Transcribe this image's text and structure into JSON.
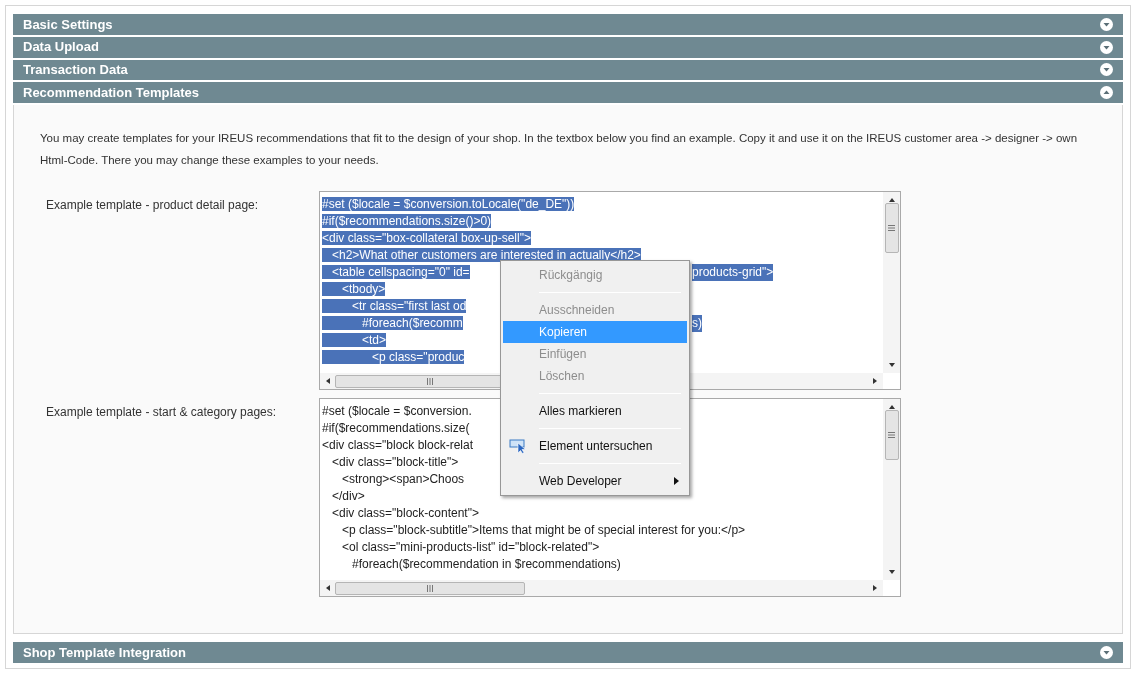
{
  "sections_top": [
    {
      "title": "Basic Settings",
      "expanded": false
    },
    {
      "title": "Data Upload",
      "expanded": false
    },
    {
      "title": "Transaction Data",
      "expanded": false
    },
    {
      "title": "Recommendation Templates",
      "expanded": true
    }
  ],
  "intro": "You may create templates for your IREUS recommendations that fit to the design of your shop. In the textbox below you find an example. Copy it and use it on the IREUS customer area -> designer -> own Html-Code. There you may change these examples to your needs.",
  "templates": [
    {
      "label": "Example template - product detail page:",
      "selected": true,
      "lines": [
        {
          "left": "#set ($locale = $conversion.toLocale(\"de_DE\"))"
        },
        {
          "left": "#if($recommendations.size()>0)"
        },
        {
          "left": "<div class=\"box-collateral box-up-sell\">"
        },
        {
          "left": "   <h2>What other customers are interested in actually</h2>"
        },
        {
          "left": "   <table cellspacing=\"0\" id=",
          "right": "products-grid\">"
        },
        {
          "left": "      <tbody>"
        },
        {
          "left": "         <tr class=\"first last od"
        },
        {
          "left": "            #foreach($recomm",
          "right": "s)"
        },
        {
          "left": "            <td>"
        },
        {
          "left": "               <p class=\"produc"
        }
      ]
    },
    {
      "label": "Example template - start & category pages:",
      "selected": false,
      "lines": [
        {
          "left": "#set ($locale = $conversion."
        },
        {
          "left": "#if($recommendations.size("
        },
        {
          "left": "<div class=\"block block-relat"
        },
        {
          "left": "   <div class=\"block-title\">"
        },
        {
          "left": "      <strong><span>Choos"
        },
        {
          "left": "   </div>"
        },
        {
          "left": "   <div class=\"block-content\">"
        },
        {
          "left": "      <p class=\"block-subtitle\">Items that might be of special interest for you:</p>"
        },
        {
          "left": "      <ol class=\"mini-products-list\" id=\"block-related\">"
        },
        {
          "left": "         #foreach($recommendation in $recommendations)"
        }
      ]
    }
  ],
  "context_menu": [
    {
      "kind": "item",
      "label": "Rückgängig",
      "disabled": true,
      "selected": false,
      "icon": false,
      "submenu": false
    },
    {
      "kind": "separator"
    },
    {
      "kind": "item",
      "label": "Ausschneiden",
      "disabled": true,
      "selected": false,
      "icon": false,
      "submenu": false
    },
    {
      "kind": "item",
      "label": "Kopieren",
      "disabled": false,
      "selected": true,
      "icon": false,
      "submenu": false
    },
    {
      "kind": "item",
      "label": "Einfügen",
      "disabled": true,
      "selected": false,
      "icon": false,
      "submenu": false
    },
    {
      "kind": "item",
      "label": "Löschen",
      "disabled": true,
      "selected": false,
      "icon": false,
      "submenu": false
    },
    {
      "kind": "separator"
    },
    {
      "kind": "item",
      "label": "Alles markieren",
      "disabled": false,
      "selected": false,
      "icon": false,
      "submenu": false
    },
    {
      "kind": "separator"
    },
    {
      "kind": "item",
      "label": "Element untersuchen",
      "disabled": false,
      "selected": false,
      "icon": true,
      "submenu": false
    },
    {
      "kind": "separator"
    },
    {
      "kind": "item",
      "label": "Web Developer",
      "disabled": false,
      "selected": false,
      "icon": false,
      "submenu": true
    }
  ],
  "sections_bottom": [
    {
      "title": "Shop Template Integration",
      "expanded": false
    }
  ]
}
